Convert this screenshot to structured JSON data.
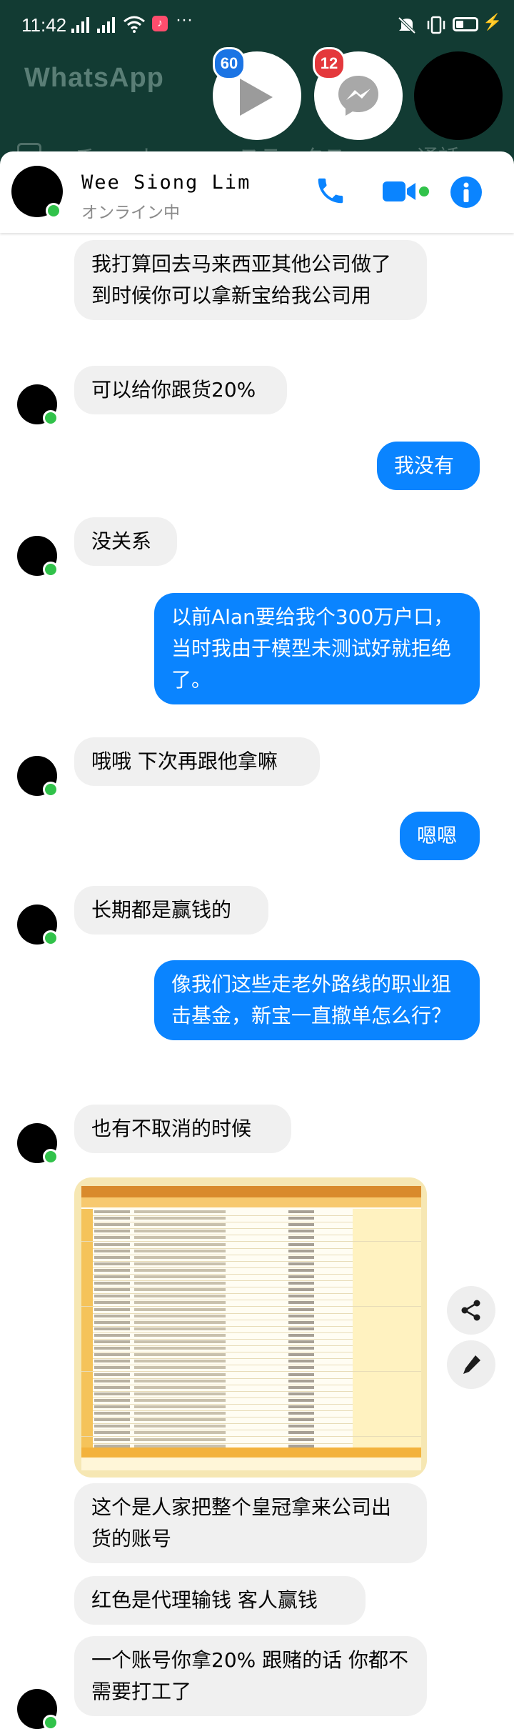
{
  "status_bar": {
    "time": "11:42",
    "right_icons": [
      "mute-icon",
      "vibrate-icon",
      "battery-icon",
      "charging-icon"
    ]
  },
  "background_app": {
    "title": "WhatsApp",
    "tabs": [
      "チャット",
      "ステータス",
      "通話"
    ]
  },
  "chat_heads": {
    "play_badge": "60",
    "messenger_badge": "12"
  },
  "header": {
    "name": "Wee Siong Lim",
    "status": "オンライン中"
  },
  "messages": [
    {
      "dir": "in",
      "text": "我打算回去马来西亚其他公司做了 到时候你可以拿新宝给我公司用"
    },
    {
      "dir": "in",
      "text": "可以给你跟货20%"
    },
    {
      "dir": "out",
      "text": "我没有"
    },
    {
      "dir": "in",
      "text": "没关系"
    },
    {
      "dir": "out",
      "text": "以前Alan要给我个300万户口，当时我由于模型未测试好就拒绝了。"
    },
    {
      "dir": "in",
      "text": "哦哦 下次再跟他拿嘛"
    },
    {
      "dir": "out",
      "text": "嗯嗯"
    },
    {
      "dir": "in",
      "text": "长期都是赢钱的"
    },
    {
      "dir": "out",
      "text": "像我们这些走老外路线的职业狙击基金，新宝一直撤单怎么行？"
    },
    {
      "dir": "in",
      "text": "也有不取消的时候"
    },
    {
      "dir": "in",
      "text": "这个是人家把整个皇冠拿来公司出货的账号"
    },
    {
      "dir": "in",
      "text": "红色是代理输钱 客人赢钱"
    },
    {
      "dir": "in",
      "text": "一个账号你拿20% 跟赌的话 你都不需要打工了"
    }
  ],
  "colors": {
    "outgoing_bubble": "#0a84ff",
    "incoming_bubble": "#f0f0f0",
    "online_dot": "#31c24a",
    "messenger_blue": "#1b74e4"
  }
}
